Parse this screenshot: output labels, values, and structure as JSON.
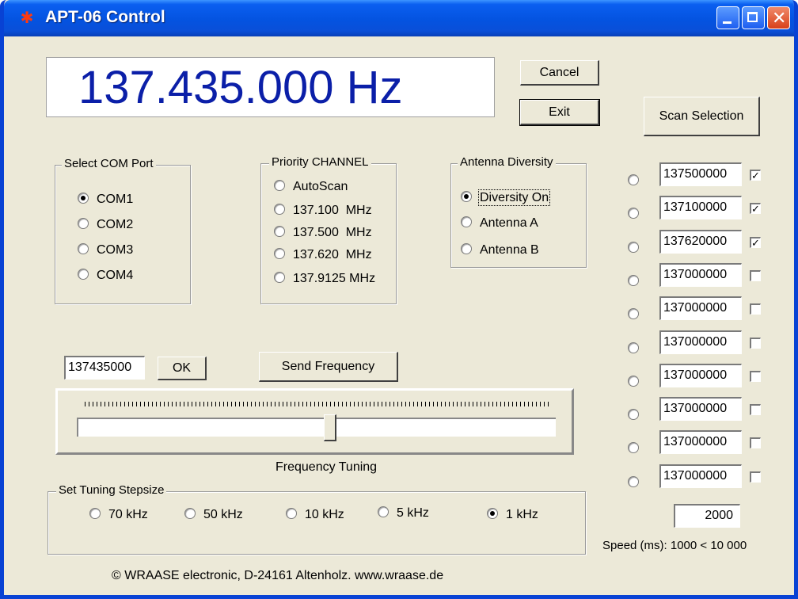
{
  "window": {
    "title": "APT-06 Control"
  },
  "display": {
    "frequency": "137.435.000 Hz"
  },
  "buttons": {
    "cancel": "Cancel",
    "exit": "Exit",
    "scan_selection": "Scan Selection",
    "ok": "OK",
    "send_frequency": "Send Frequency"
  },
  "com_port": {
    "legend": "Select COM Port",
    "options": [
      {
        "label": "COM1",
        "checked": true
      },
      {
        "label": "COM2",
        "checked": false
      },
      {
        "label": "COM3",
        "checked": false
      },
      {
        "label": "COM4",
        "checked": false
      }
    ]
  },
  "priority": {
    "legend": "Priority CHANNEL",
    "options": [
      {
        "label": "AutoScan",
        "checked": false
      },
      {
        "label": "137.100  MHz",
        "checked": false
      },
      {
        "label": "137.500  MHz",
        "checked": false
      },
      {
        "label": "137.620  MHz",
        "checked": false
      },
      {
        "label": "137.9125 MHz",
        "checked": false
      }
    ]
  },
  "antenna": {
    "legend": "Antenna Diversity",
    "options": [
      {
        "label": "Diversity On",
        "checked": true
      },
      {
        "label": "Antenna A",
        "checked": false
      },
      {
        "label": "Antenna B",
        "checked": false
      }
    ]
  },
  "frequency_input": {
    "value": "137435000"
  },
  "tuning": {
    "label": "Frequency Tuning",
    "position": 0.53
  },
  "stepsize": {
    "legend": "Set Tuning Stepsize",
    "options": [
      {
        "label": "70 kHz",
        "checked": false
      },
      {
        "label": "50 kHz",
        "checked": false
      },
      {
        "label": "10 kHz",
        "checked": false
      },
      {
        "label": "5 kHz",
        "checked": false
      },
      {
        "label": "1 kHz",
        "checked": true
      }
    ]
  },
  "scan_channels": [
    {
      "value": "137500000",
      "selected": true
    },
    {
      "value": "137100000",
      "selected": true
    },
    {
      "value": "137620000",
      "selected": true
    },
    {
      "value": "137000000",
      "selected": false
    },
    {
      "value": "137000000",
      "selected": false
    },
    {
      "value": "137000000",
      "selected": false
    },
    {
      "value": "137000000",
      "selected": false
    },
    {
      "value": "137000000",
      "selected": false
    },
    {
      "value": "137000000",
      "selected": false
    },
    {
      "value": "137000000",
      "selected": false
    }
  ],
  "speed": {
    "value": "2000",
    "label": "Speed (ms): 1000 < 10 000"
  },
  "footer": {
    "copyright": "©  WRAASE electronic, D-24161 Altenholz. www.wraase.de"
  }
}
